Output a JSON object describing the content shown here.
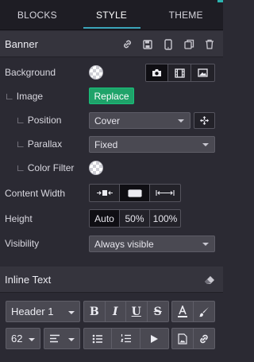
{
  "tabs": [
    {
      "label": "BLOCKS"
    },
    {
      "label": "STYLE"
    },
    {
      "label": "THEME"
    }
  ],
  "banner": {
    "title": "Banner",
    "icons": [
      "link-icon",
      "save-icon",
      "mobile-icon",
      "copy-icon",
      "trash-icon"
    ]
  },
  "rows": {
    "background": {
      "label": "Background",
      "types": [
        "camera-icon",
        "film-icon",
        "image-icon"
      ],
      "active_type": "camera-icon"
    },
    "image": {
      "label": "Image",
      "tree": "∟",
      "button": "Replace"
    },
    "position": {
      "label": "Position",
      "tree": "∟",
      "value": "Cover"
    },
    "parallax": {
      "label": "Parallax",
      "tree": "∟",
      "value": "Fixed"
    },
    "color_filter": {
      "label": "Color Filter",
      "tree": "∟"
    },
    "content_width": {
      "label": "Content Width",
      "options": [
        "narrow-width-icon",
        "medium-width-icon",
        "full-width-icon"
      ],
      "active": "medium-width-icon"
    },
    "height": {
      "label": "Height",
      "options": [
        "Auto",
        "50%",
        "100%"
      ],
      "active": "Auto"
    },
    "visibility": {
      "label": "Visibility",
      "value": "Always visible"
    }
  },
  "inline_text": {
    "title": "Inline Text",
    "icon": "eraser-icon",
    "heading_value": "Header 1",
    "size_value": "62",
    "format_buttons": [
      "B",
      "I",
      "U",
      "S"
    ],
    "colors": {
      "accent": "#1fa36a",
      "tab_underline": "#3aa3b8",
      "bg": "#2b2a33"
    }
  }
}
